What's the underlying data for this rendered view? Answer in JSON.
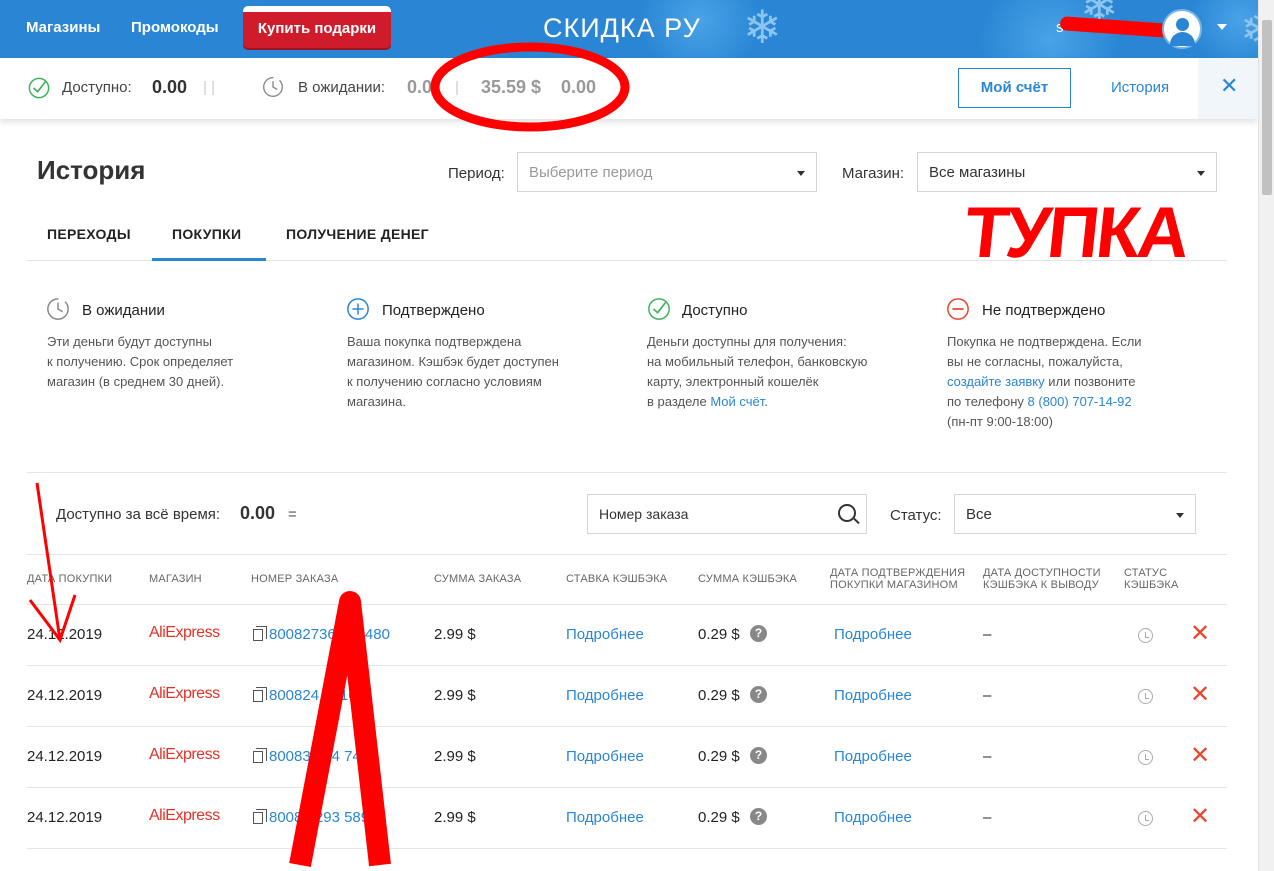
{
  "topbar": {
    "nav_shops": "Магазины",
    "nav_promo": "Промокоды",
    "gift_button": "Купить подарки",
    "logo": "СКИДКА РУ",
    "user_initial": "s"
  },
  "balance": {
    "available_label": "Доступно:",
    "available_value": "0.00",
    "pending_label": "В ожидании:",
    "pending_value": "0.0",
    "pending_value_2": "35.59 $",
    "pending_value_3": "0.00",
    "account_button": "Мой счёт",
    "history_link": "История"
  },
  "page": {
    "title": "История",
    "period_label": "Период:",
    "period_placeholder": "Выберите период",
    "shop_label": "Магазин:",
    "shop_value": "Все магазины"
  },
  "tabs": [
    {
      "label": "ПЕРЕХОДЫ",
      "active": false
    },
    {
      "label": "ПОКУПКИ",
      "active": true
    },
    {
      "label": "ПОЛУЧЕНИЕ ДЕНЕГ",
      "active": false
    }
  ],
  "legend": [
    {
      "title": "В ожидании",
      "lines": [
        "Эти деньги будут доступны",
        "к получению. Срок определяет",
        "магазин (в среднем 30 дней)."
      ],
      "color": "#888888"
    },
    {
      "title": "Подтверждено",
      "lines": [
        "Ваша покупка подтверждена",
        "магазином. Кэшбэк будет доступен",
        "к получению согласно условиям",
        "магазина."
      ],
      "color": "#2a86d4"
    },
    {
      "title": "Доступно",
      "lines": [
        "Деньги доступны для получения:",
        "на мобильный телефон, банковскую",
        "карту, электронный кошелёк"
      ],
      "line4_prefix": "в разделе ",
      "line4_link": "Мой счёт",
      "line4_suffix": ".",
      "color": "#3cb35a"
    },
    {
      "title": "Не подтверждено",
      "line1": "Покупка не подтверждена. Если",
      "line2": "вы не согласны, пожалуйста,",
      "line3_link": "создайте заявку",
      "line3_suffix": " или позвоните",
      "line4_prefix": "по телефону ",
      "line4_link": "8 (800) 707-14-92",
      "line5": "(пн-пт 9:00-18:00)",
      "color": "#e8472e"
    }
  ],
  "filters": {
    "total_label": "Доступно за всё время:",
    "total_value": "0.00",
    "order_search_placeholder": "Номер заказа",
    "status_label": "Статус:",
    "status_value": "Все"
  },
  "table": {
    "headers": [
      "ДАТА ПОКУПКИ",
      "МАГАЗИН",
      "НОМЕР ЗАКАЗА",
      "СУММА ЗАКАЗА",
      "СТАВКА КЭШБЭКА",
      "СУММА КЭШБЭКА",
      "ДАТА ПОДТВЕРЖДЕНИЯ",
      "ПОКУПКИ МАГАЗИНОМ",
      "ДАТА ДОСТУПНОСТИ",
      "КЭШБЭКА К ВЫВОДУ",
      "СТАТУС",
      "КЭШБЭКА"
    ],
    "rows": [
      {
        "date": "24.12.2019",
        "shop": "AliExpress",
        "order": "80082736 097480",
        "amount": "2.99 $",
        "rate": "Подробнее",
        "cashback": "0.29 $",
        "confirm": "Подробнее",
        "available": "–"
      },
      {
        "date": "24.12.2019",
        "shop": "AliExpress",
        "order": "800824 7416",
        "amount": "2.99 $",
        "rate": "Подробнее",
        "cashback": "0.29 $",
        "confirm": "Подробнее",
        "available": "–"
      },
      {
        "date": "24.12.2019",
        "shop": "AliExpress",
        "order": "80083 644 7403",
        "amount": "2.99 $",
        "rate": "Подробнее",
        "cashback": "0.29 $",
        "confirm": "Подробнее",
        "available": "–"
      },
      {
        "date": "24.12.2019",
        "shop": "AliExpress",
        "order": "8008 5293 589",
        "amount": "2.99 $",
        "rate": "Подробнее",
        "cashback": "0.29 $",
        "confirm": "Подробнее",
        "available": "–"
      }
    ]
  },
  "annotation": {
    "word": "ТУПКА",
    "color": "#ff0000"
  },
  "colors": {
    "brand_blue": "#2a86d4",
    "gift_red": "#d01c2a",
    "ali_red": "#e43225",
    "reject_red": "#e8472e"
  }
}
